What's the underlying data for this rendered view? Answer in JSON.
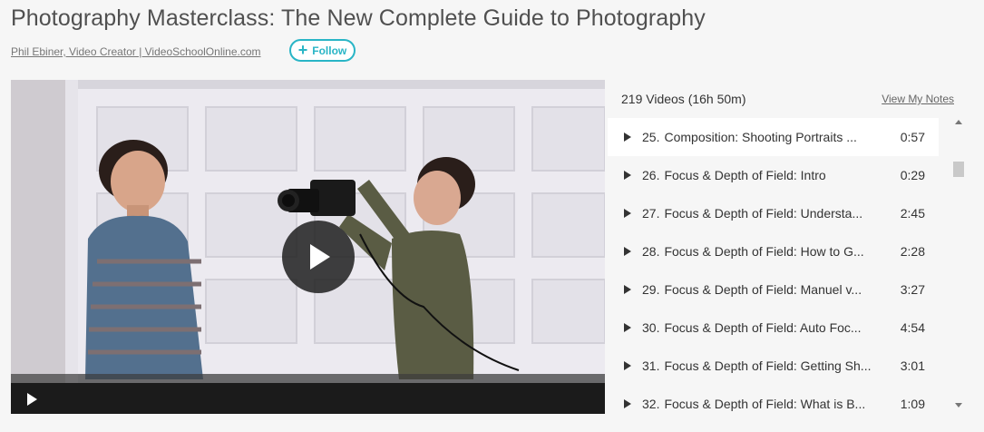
{
  "course": {
    "title": "Photography Masterclass: The New Complete Guide to Photography",
    "instructor": "Phil Ebiner, Video Creator | VideoSchoolOnline.com",
    "follow_label": "Follow"
  },
  "playlist": {
    "count_label": "219 Videos (16h 50m)",
    "notes_label": "View My Notes",
    "items": [
      {
        "num": "25.",
        "title": "Composition: Shooting Portraits ...",
        "duration": "0:57"
      },
      {
        "num": "26.",
        "title": "Focus & Depth of Field: Intro",
        "duration": "0:29"
      },
      {
        "num": "27.",
        "title": "Focus & Depth of Field: Understa...",
        "duration": "2:45"
      },
      {
        "num": "28.",
        "title": "Focus & Depth of Field: How to G...",
        "duration": "2:28"
      },
      {
        "num": "29.",
        "title": "Focus & Depth of Field: Manuel v...",
        "duration": "3:27"
      },
      {
        "num": "30.",
        "title": "Focus & Depth of Field: Auto Foc...",
        "duration": "4:54"
      },
      {
        "num": "31.",
        "title": "Focus & Depth of Field: Getting Sh...",
        "duration": "3:01"
      },
      {
        "num": "32.",
        "title": "Focus & Depth of Field: What is B...",
        "duration": "1:09"
      }
    ]
  },
  "icons": {
    "follow": "plus-icon",
    "video_play": "play-icon",
    "item": "play-triangle-icon"
  },
  "colors": {
    "accent": "#29b5c6",
    "active_row": "#ffffff",
    "background": "#f6f6f6"
  }
}
